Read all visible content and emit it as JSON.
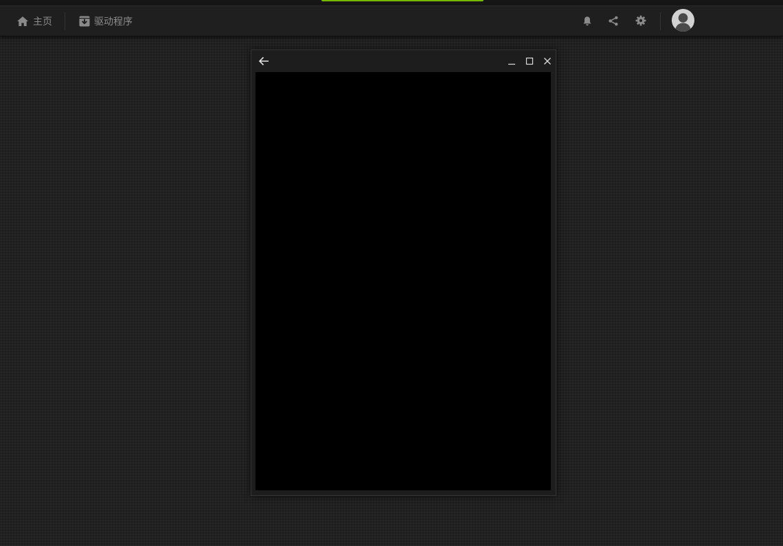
{
  "colors": {
    "accent": "#76b900",
    "nav_text": "#8e8e8e",
    "icon": "#8a8a8a",
    "modal_content_bg": "#000000"
  },
  "navbar": {
    "home": {
      "label": "主页",
      "icon": "home-icon"
    },
    "drivers": {
      "label": "驱动程序",
      "icon": "driver-package-icon"
    },
    "tools": [
      {
        "name": "notifications",
        "icon": "bell-icon"
      },
      {
        "name": "share",
        "icon": "share-icon"
      },
      {
        "name": "settings",
        "icon": "gear-icon"
      }
    ],
    "avatar": {
      "icon": "user-avatar-icon"
    }
  },
  "modal": {
    "back_icon": "arrow-left-icon",
    "window_controls": [
      "minimize-icon",
      "maximize-icon",
      "close-icon"
    ]
  }
}
